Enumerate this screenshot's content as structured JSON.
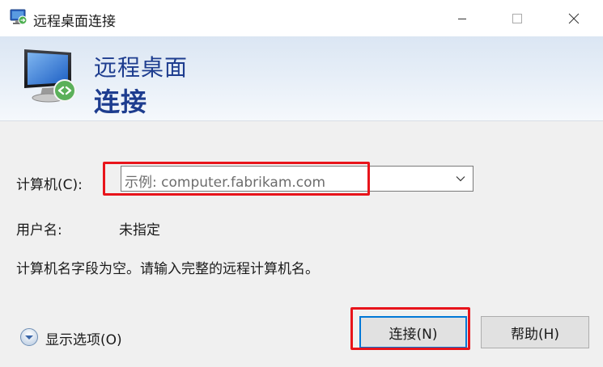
{
  "window": {
    "title": "远程桌面连接",
    "controls": {
      "minimize": "minimize-icon",
      "maximize": "maximize-icon",
      "close": "close-icon"
    }
  },
  "banner": {
    "line1": "远程桌面",
    "line2": "连接"
  },
  "form": {
    "computer_label": "计算机(C):",
    "computer_placeholder": "示例: computer.fabrikam.com",
    "computer_value": "",
    "username_label": "用户名:",
    "username_value": "未指定",
    "message": "计算机名字段为空。请输入完整的远程计算机名。"
  },
  "footer": {
    "options_label": "显示选项(O)",
    "connect_label": "连接(N)",
    "help_label": "帮助(H)"
  },
  "colors": {
    "banner_text": "#1e3d8f",
    "highlight": "#e8141b",
    "focus_border": "#0078d7"
  }
}
